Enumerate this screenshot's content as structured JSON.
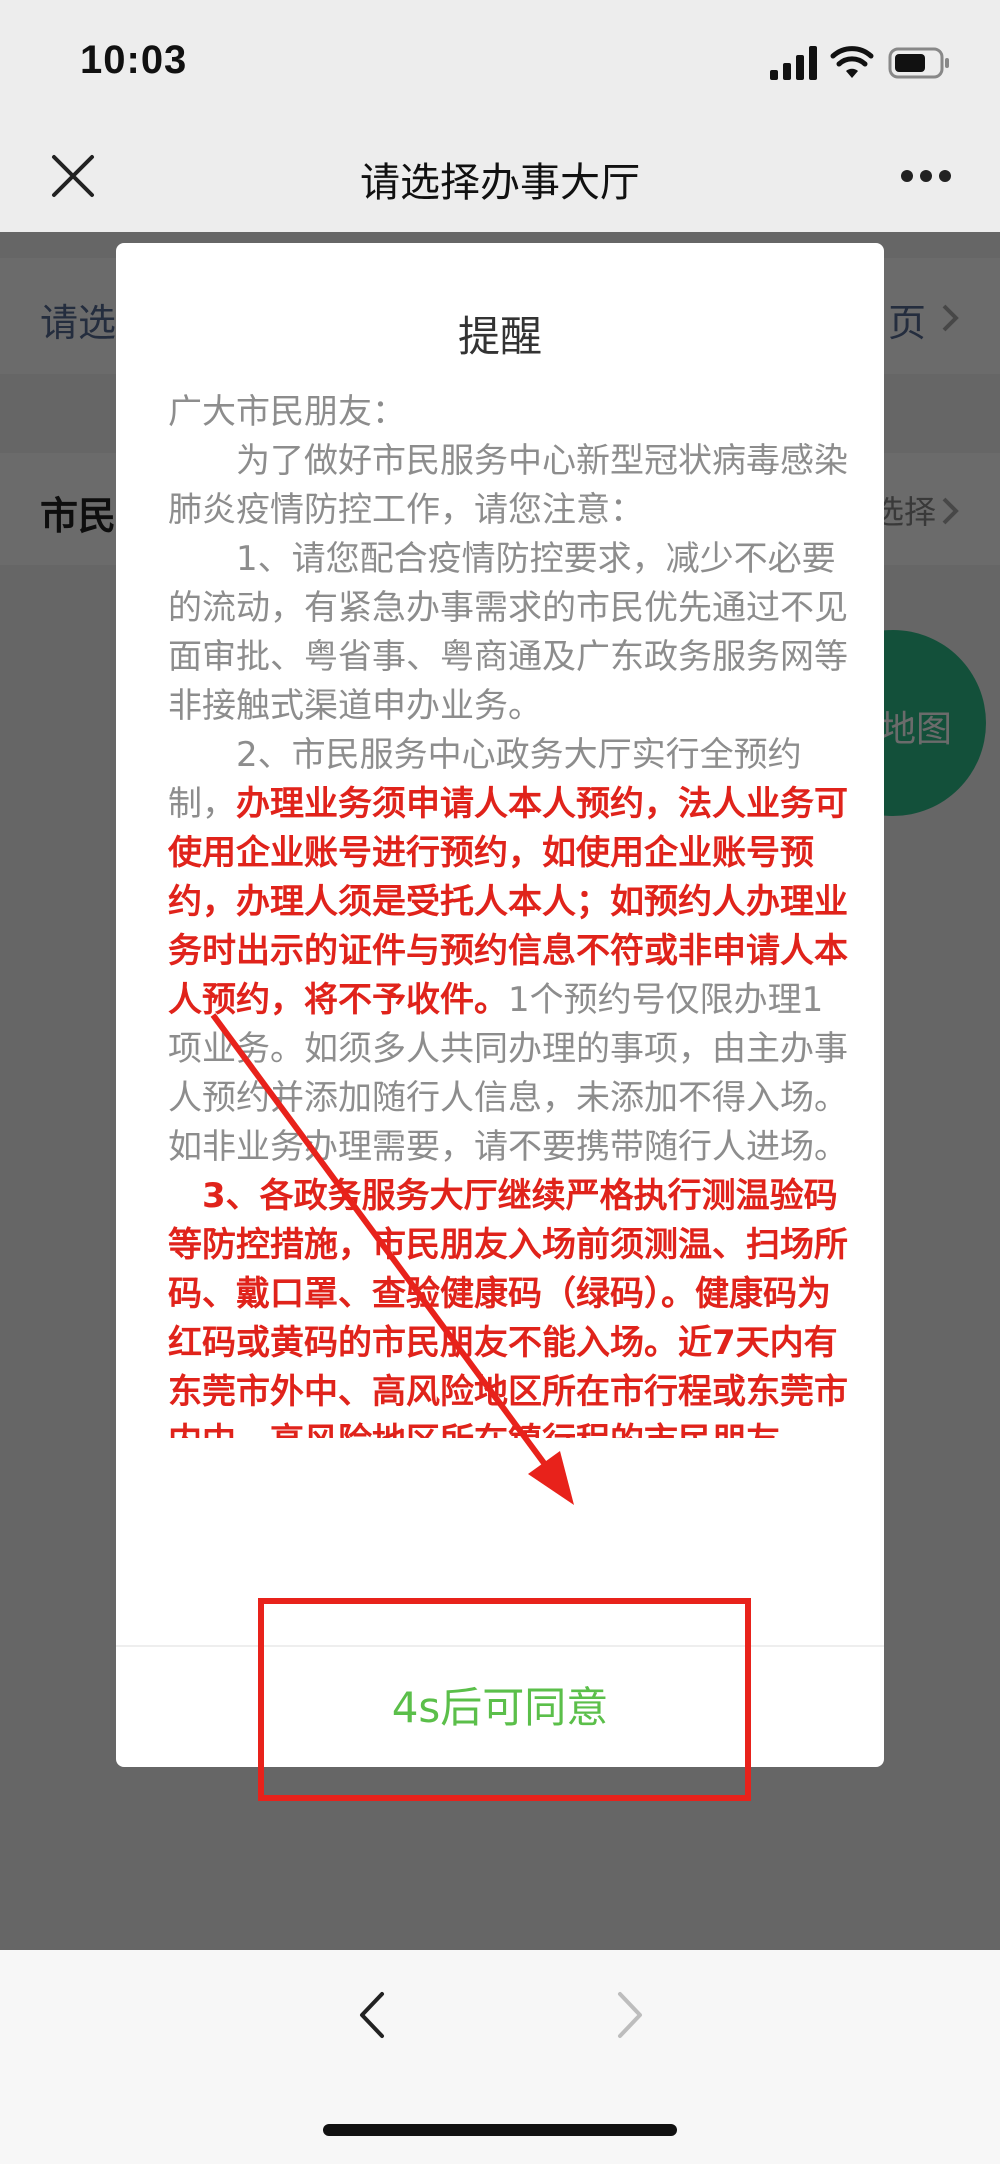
{
  "status_bar": {
    "time": "10:03"
  },
  "nav": {
    "title": "请选择办事大厅"
  },
  "background_page": {
    "row1_left": "请选",
    "row1_right": "页",
    "row2_left": "市民",
    "row2_right": "选择",
    "map_button": "地图"
  },
  "dialog": {
    "title": "提醒",
    "greeting": "广大市民朋友：",
    "p1": "为了做好市民服务中心新型冠状病毒感染肺炎疫情防控工作，请您注意：",
    "p2": "1、请您配合疫情防控要求，减少不必要的流动，有紧急办事需求的市民优先通过不见面审批、粤省事、粤商通及广东政务服务网等非接触式渠道申办业务。",
    "p3_a": "2、市民服务中心政务大厅实行全预约制，",
    "p3_red": "办理业务须申请人本人预约，法人业务可使用企业账号进行预约，如使用企业账号预约，办理人须是受托人本人；如预约人办理业务时出示的证件与预约信息不符或非申请人本人预约，将不予收件。",
    "p3_b": "1个预约号仅限办理1项业务。如须多人共同办理的事项，由主办事人预约并添加随行人信息，未添加不得入场。如非业务办理需要，请不要携带随行人进场。",
    "p4_red": "3、各政务服务大厅继续严格执行测温验码等防控措施，市民朋友入场前须测温、扫场所码、戴口罩、查验健康码（绿码）。健康码为红码或黄码的市民朋友不能入场。近7天内有东莞市外中、高风险地区所在市行程或东莞市内中、高风险地区所在镇行程的市民朋友，",
    "agree_button": "4s后可同意"
  },
  "colors": {
    "annotation_red": "#e8221b",
    "agree_green": "#5bbf4a",
    "emphasis_red": "#e0231b"
  }
}
